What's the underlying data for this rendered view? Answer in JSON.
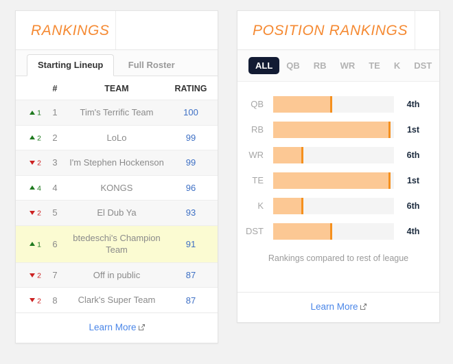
{
  "rankings_panel": {
    "title": "RANKINGS",
    "tabs": [
      {
        "label": "Starting Lineup",
        "active": true
      },
      {
        "label": "Full Roster",
        "active": false
      }
    ],
    "columns": {
      "move": "",
      "position": "#",
      "team": "TEAM",
      "rating": "RATING"
    },
    "rows": [
      {
        "direction": "up",
        "change": "1",
        "position": "1",
        "team": "Tim's Terrific Team",
        "rating": "100",
        "highlight": false
      },
      {
        "direction": "up",
        "change": "2",
        "position": "2",
        "team": "LoLo",
        "rating": "99",
        "highlight": false
      },
      {
        "direction": "down",
        "change": "2",
        "position": "3",
        "team": "I'm Stephen Hockenson",
        "rating": "99",
        "highlight": false
      },
      {
        "direction": "up",
        "change": "4",
        "position": "4",
        "team": "KONGS",
        "rating": "96",
        "highlight": false
      },
      {
        "direction": "down",
        "change": "2",
        "position": "5",
        "team": "El Dub Ya",
        "rating": "93",
        "highlight": false
      },
      {
        "direction": "up",
        "change": "1",
        "position": "6",
        "team": "btedeschi's Champion Team",
        "rating": "91",
        "highlight": true
      },
      {
        "direction": "down",
        "change": "2",
        "position": "7",
        "team": "Off in public",
        "rating": "87",
        "highlight": false
      },
      {
        "direction": "down",
        "change": "2",
        "position": "8",
        "team": "Clark's Super Team",
        "rating": "87",
        "highlight": false
      }
    ],
    "footer_link": "Learn More",
    "footer_icon": "external-link-icon"
  },
  "position_panel": {
    "title": "POSITION RANKINGS",
    "filters": [
      {
        "label": "ALL",
        "active": true
      },
      {
        "label": "QB",
        "active": false
      },
      {
        "label": "RB",
        "active": false
      },
      {
        "label": "WR",
        "active": false
      },
      {
        "label": "TE",
        "active": false
      },
      {
        "label": "K",
        "active": false
      },
      {
        "label": "DST",
        "active": false
      }
    ],
    "caption": "Rankings compared to rest of league",
    "footer_link": "Learn More",
    "footer_icon": "external-link-icon"
  },
  "chart_data": {
    "type": "bar",
    "title": "POSITION RANKINGS",
    "subtitle": "Rankings compared to rest of league",
    "orientation": "horizontal",
    "categories": [
      "QB",
      "RB",
      "WR",
      "TE",
      "K",
      "DST"
    ],
    "values": [
      49,
      97,
      25,
      97,
      25,
      49
    ],
    "value_labels": [
      "4th",
      "1st",
      "6th",
      "1st",
      "6th",
      "4th"
    ],
    "xlabel": "",
    "ylabel": "",
    "xlim": [
      0,
      100
    ],
    "grid": false,
    "legend": null,
    "colors": {
      "bar_fill": "#fcc894",
      "bar_edge": "#f5901e",
      "track": "#f4f4f4",
      "label": "#a6a6a6",
      "rank_label": "#1b2a3d"
    }
  },
  "theme": {
    "accent": "#f58a33",
    "link": "#4a86e8",
    "rating_text": "#3d6fc4",
    "up": "#1f7a1f",
    "down": "#cc2222",
    "highlight_row": "#fbfbd2",
    "active_pill": "#121b33",
    "page_background": "#f2f2f2"
  }
}
